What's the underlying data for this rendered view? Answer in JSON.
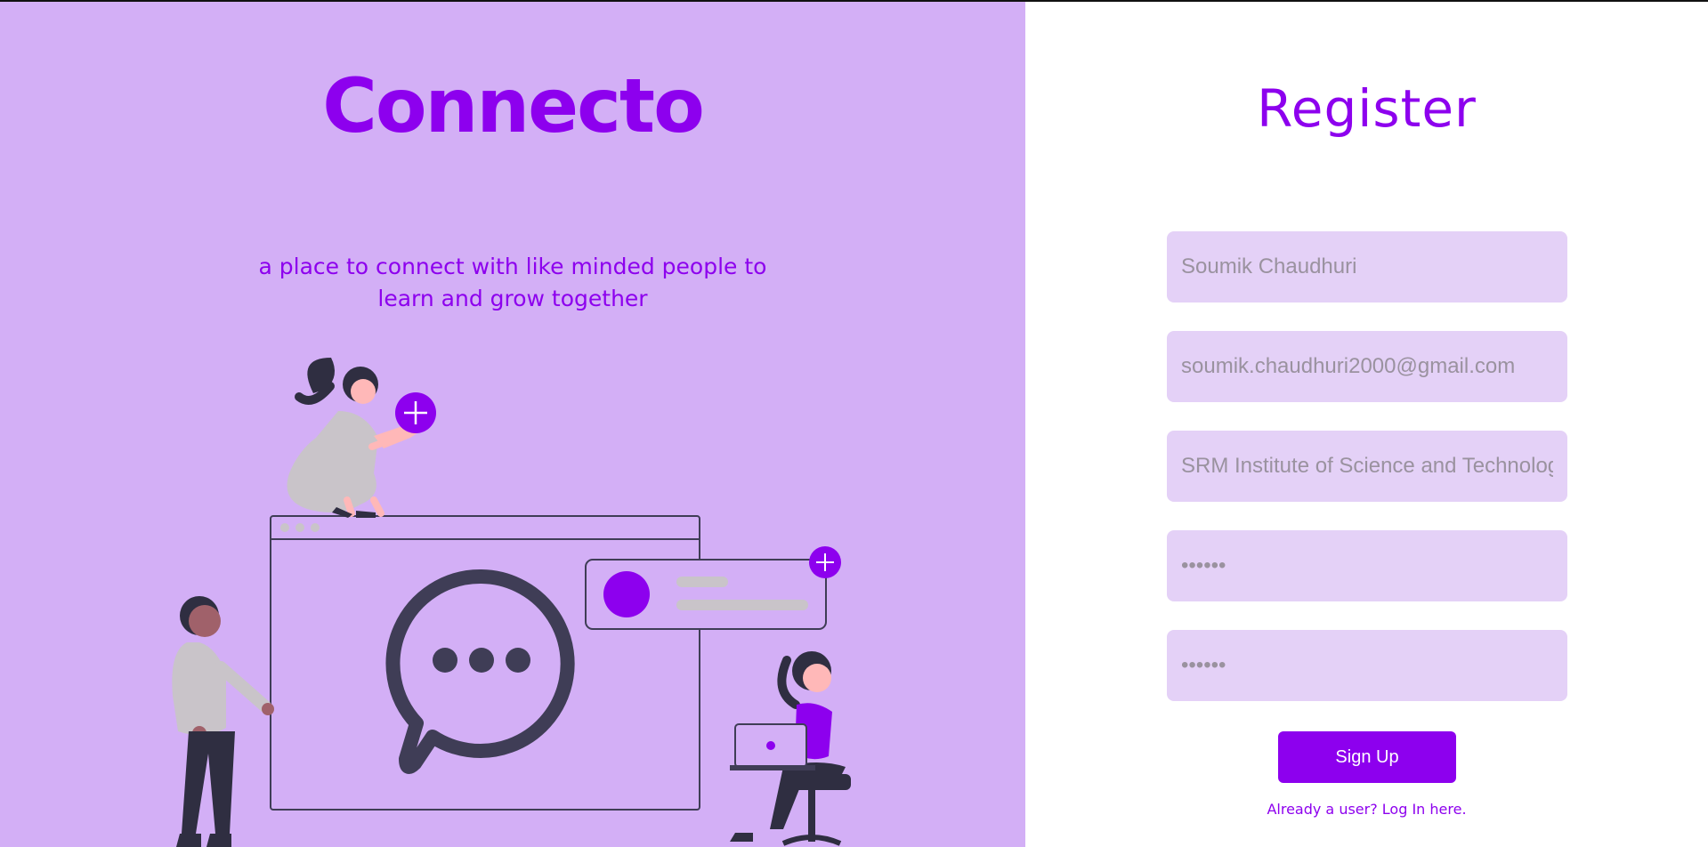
{
  "brand": {
    "name": "Connecto"
  },
  "tagline": {
    "line1": "a place to connect with like minded people to",
    "line2": "learn and grow together"
  },
  "form": {
    "title": "Register",
    "fields": [
      {
        "name": "full-name",
        "value": "Soumik Chaudhuri",
        "type": "text"
      },
      {
        "name": "email",
        "value": "soumik.chaudhuri2000@gmail.com",
        "type": "email"
      },
      {
        "name": "institution",
        "value": "SRM Institute of Science and Technology",
        "type": "text"
      },
      {
        "name": "password",
        "value": "••••••",
        "type": "password"
      },
      {
        "name": "confirm-password",
        "value": "••••••",
        "type": "password"
      }
    ],
    "submit_label": "Sign Up",
    "login_prompt": "Already a user? Log In here."
  },
  "colors": {
    "brand": "#8d00ee",
    "left_panel": "#d3aff6",
    "input_bg": "#e4d1f7",
    "illustration_dark": "#3f3d56"
  },
  "icons": [
    "plus-icon",
    "chat-bubble-icon",
    "avatar-icon",
    "laptop-icon"
  ]
}
